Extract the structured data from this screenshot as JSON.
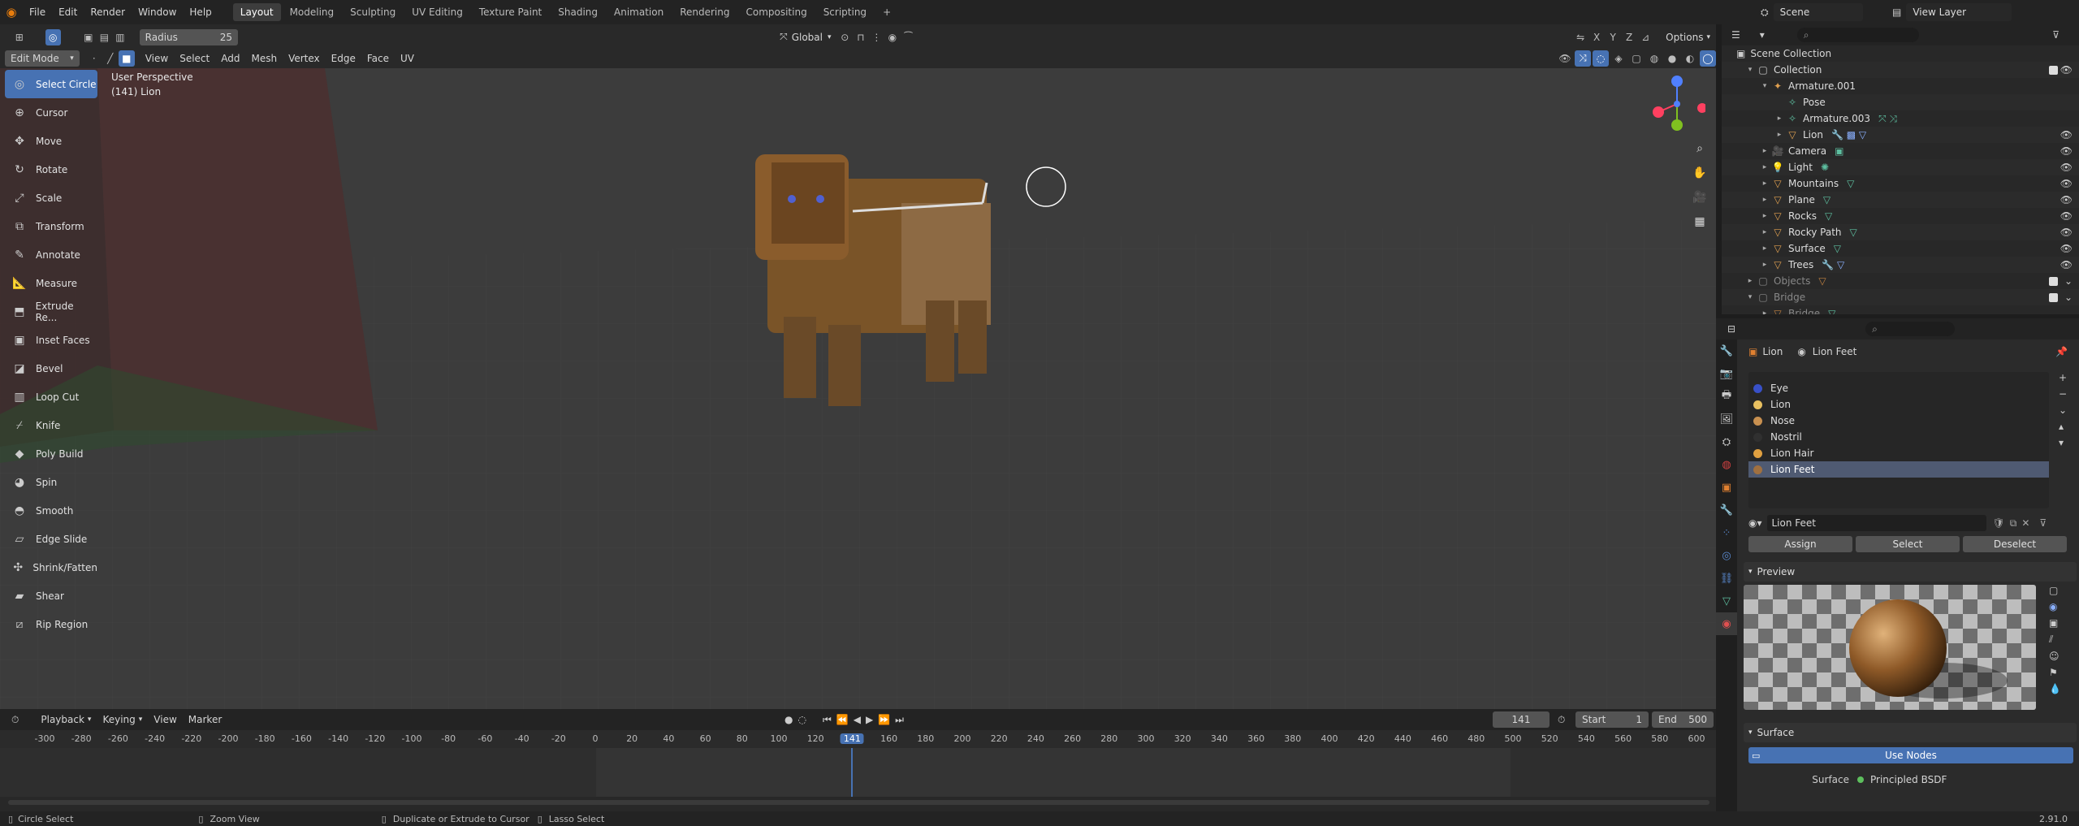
{
  "topbar": {
    "menus": [
      "File",
      "Edit",
      "Render",
      "Window",
      "Help"
    ],
    "workspaces": [
      "Layout",
      "Modeling",
      "Sculpting",
      "UV Editing",
      "Texture Paint",
      "Shading",
      "Animation",
      "Rendering",
      "Compositing",
      "Scripting"
    ],
    "active_workspace": "Layout",
    "add_tab": "+",
    "radius_label": "Radius",
    "radius_value": "25",
    "scene_label": "Scene",
    "view_layer_label": "View Layer",
    "transform_orientation": "Global",
    "options_label": "Options",
    "axes": [
      "X",
      "Y",
      "Z"
    ]
  },
  "viewport": {
    "mode": "Edit Mode",
    "menus": [
      "View",
      "Select",
      "Add",
      "Mesh",
      "Vertex",
      "Edge",
      "Face",
      "UV"
    ],
    "info_line1": "User Perspective",
    "info_line2": "(141) Lion",
    "tools": [
      "Select Circle",
      "Cursor",
      "Move",
      "Rotate",
      "Scale",
      "Transform",
      "Annotate",
      "Measure",
      "Extrude Re...",
      "Inset Faces",
      "Bevel",
      "Loop Cut",
      "Knife",
      "Poly Build",
      "Spin",
      "Smooth",
      "Edge Slide",
      "Shrink/Fatten",
      "Shear",
      "Rip Region"
    ],
    "gizmo_axes": [
      "X",
      "Y",
      "Z"
    ]
  },
  "outliner": {
    "root": "Scene Collection",
    "rows": [
      {
        "label": "Collection",
        "indent": 1
      },
      {
        "label": "Armature.001",
        "indent": 2
      },
      {
        "label": "Pose",
        "indent": 3
      },
      {
        "label": "Armature.003",
        "indent": 3
      },
      {
        "label": "Lion",
        "indent": 3
      },
      {
        "label": "Camera",
        "indent": 2
      },
      {
        "label": "Light",
        "indent": 2
      },
      {
        "label": "Mountains",
        "indent": 2
      },
      {
        "label": "Plane",
        "indent": 2
      },
      {
        "label": "Rocks",
        "indent": 2
      },
      {
        "label": "Rocky Path",
        "indent": 2
      },
      {
        "label": "Surface",
        "indent": 2
      },
      {
        "label": "Trees",
        "indent": 2
      },
      {
        "label": "Objects",
        "indent": 1
      },
      {
        "label": "Bridge",
        "indent": 1
      },
      {
        "label": "Bridge",
        "indent": 2
      }
    ]
  },
  "properties": {
    "object_name": "Lion",
    "material_name": "Lion Feet",
    "slots": [
      {
        "name": "Eye",
        "color": "#3850c8"
      },
      {
        "name": "Lion",
        "color": "#e8c060"
      },
      {
        "name": "Nose",
        "color": "#c89050"
      },
      {
        "name": "Nostril",
        "color": "#303030"
      },
      {
        "name": "Lion Hair",
        "color": "#e0a040"
      },
      {
        "name": "Lion Feet",
        "color": "#a07040"
      }
    ],
    "active_material": "Lion Feet",
    "assign": "Assign",
    "select": "Select",
    "deselect": "Deselect",
    "preview_title": "Preview",
    "surface_title": "Surface",
    "use_nodes": "Use Nodes",
    "surface_label": "Surface",
    "surface_value": "Principled BSDF"
  },
  "timeline": {
    "menus": [
      "Playback",
      "Keying",
      "View",
      "Marker"
    ],
    "current_frame": "141",
    "start_label": "Start",
    "start_value": "1",
    "end_label": "End",
    "end_value": "500",
    "ticks": [
      "-300",
      "-280",
      "-260",
      "-240",
      "-220",
      "-200",
      "-180",
      "-160",
      "-140",
      "-120",
      "-100",
      "-80",
      "-60",
      "-40",
      "-20",
      "0",
      "20",
      "40",
      "60",
      "80",
      "100",
      "120",
      "141",
      "160",
      "180",
      "200",
      "220",
      "240",
      "260",
      "280",
      "300",
      "320",
      "340",
      "360",
      "380",
      "400",
      "420",
      "440",
      "460",
      "480",
      "500",
      "520",
      "540",
      "560",
      "580",
      "600"
    ]
  },
  "statusbar": {
    "items": [
      "Circle Select",
      "Zoom View",
      "Duplicate or Extrude to Cursor",
      "Lasso Select"
    ],
    "version": "2.91.0"
  },
  "colors": {
    "accent": "#4772b3",
    "frame_indicator": "#4772b3",
    "blender_orange": "#e87d0d"
  }
}
